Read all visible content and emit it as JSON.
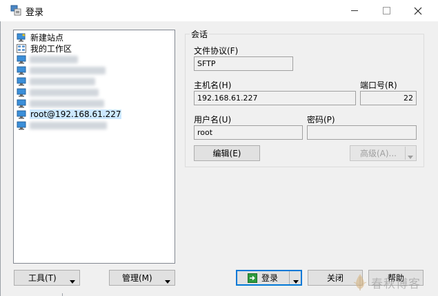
{
  "window": {
    "title": "登录"
  },
  "sites": {
    "items": [
      {
        "label": "新建站点",
        "icon": "new-site-icon"
      },
      {
        "label": "我的工作区",
        "icon": "workspace-icon"
      },
      {
        "label": "",
        "icon": "computer-icon",
        "redacted": true
      },
      {
        "label": "",
        "icon": "computer-icon",
        "redacted": true
      },
      {
        "label": "",
        "icon": "computer-icon",
        "redacted": true
      },
      {
        "label": "",
        "icon": "computer-icon",
        "redacted": true
      },
      {
        "label": "",
        "icon": "computer-icon",
        "redacted": true
      },
      {
        "label": "root@192.168.61.227",
        "icon": "computer-icon",
        "selected": true
      },
      {
        "label": "",
        "icon": "computer-icon",
        "redacted": true
      }
    ]
  },
  "session": {
    "group_title": "会话",
    "protocol_label": "文件协议(F)",
    "protocol_value": "SFTP",
    "host_label": "主机名(H)",
    "host_value": "192.168.61.227",
    "port_label": "端口号(R)",
    "port_value": "22",
    "user_label": "用户名(U)",
    "user_value": "root",
    "password_label": "密码(P)",
    "password_value": "",
    "edit_button": "编辑(E)",
    "advanced_button": "高级(A)..."
  },
  "footer": {
    "tools_button": "工具(T)",
    "manage_button": "管理(M)",
    "login_button": "登录",
    "close_button": "关闭",
    "help_button": "帮助"
  },
  "watermark": {
    "text": "春秋博客"
  },
  "colors": {
    "selection": "#cce8ff",
    "accent": "#0078d7",
    "login_icon": "#2e9a3e"
  }
}
